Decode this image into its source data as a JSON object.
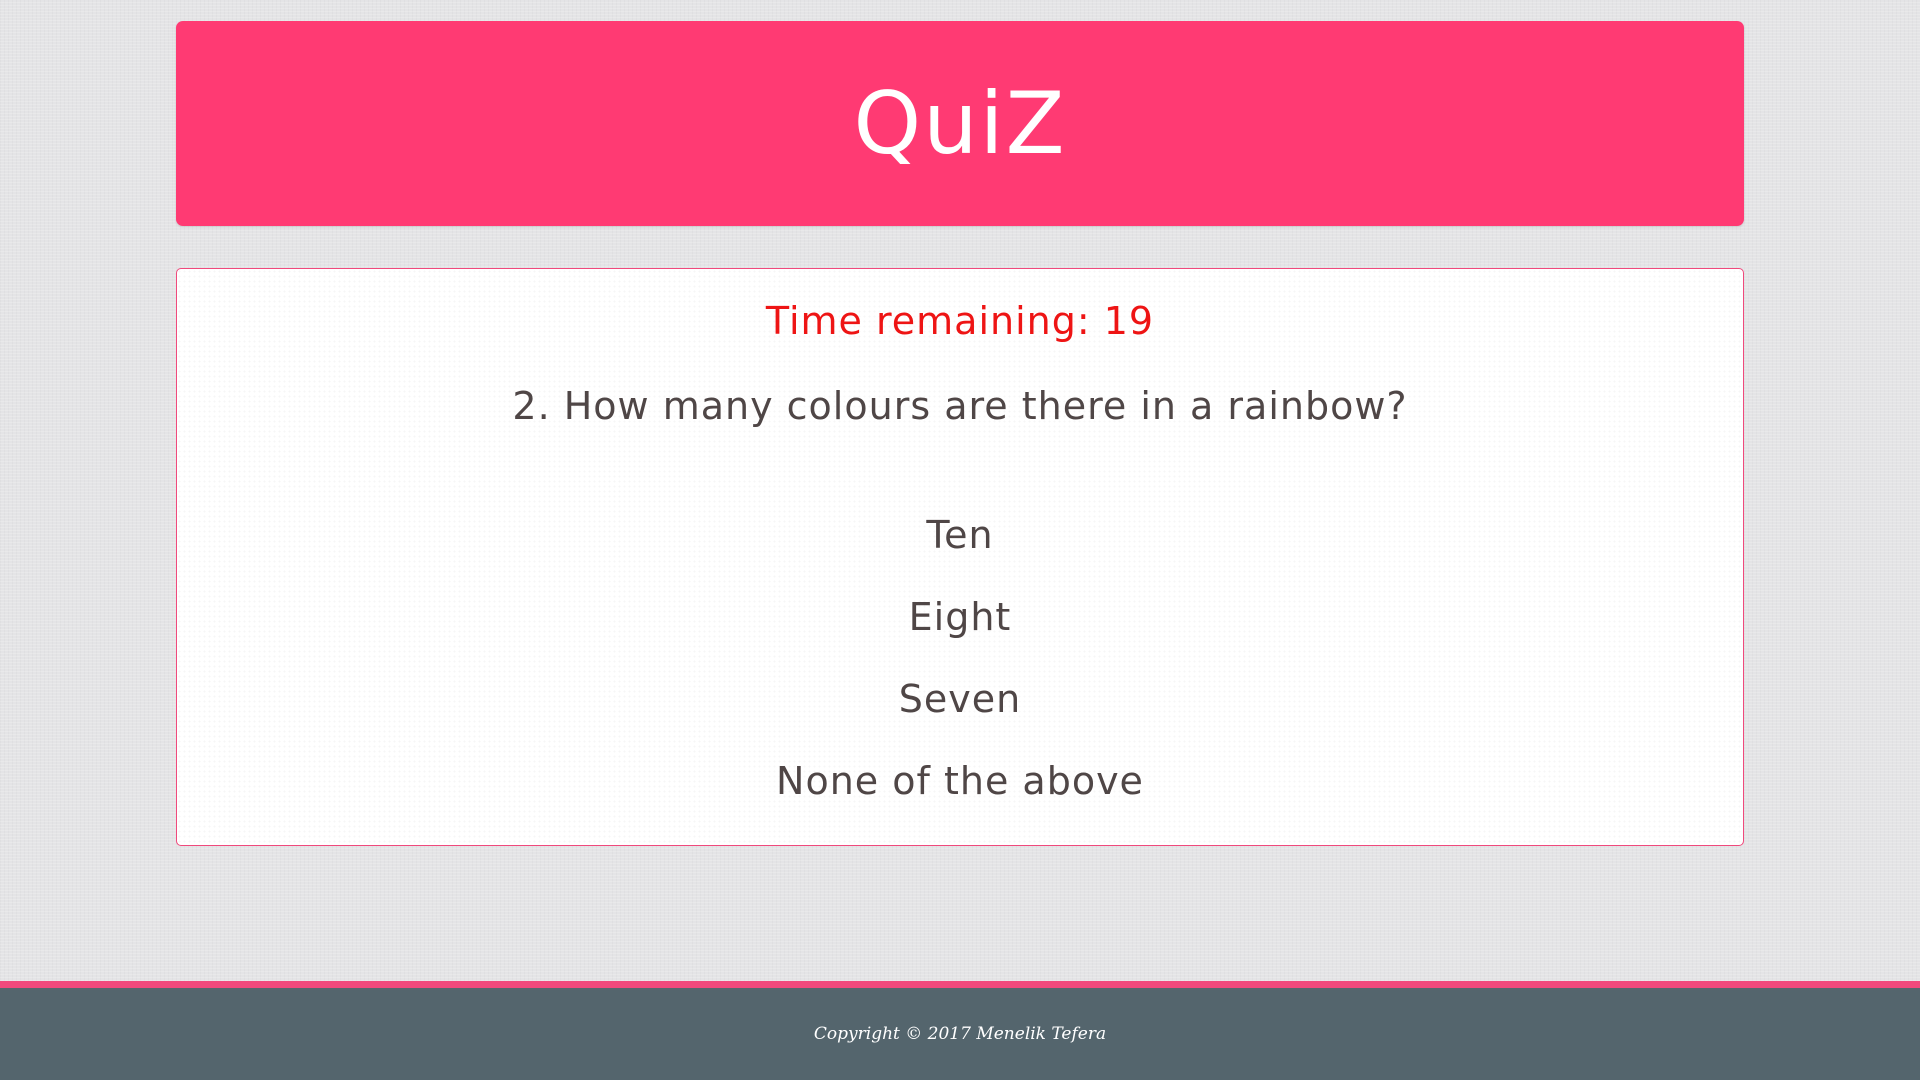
{
  "header": {
    "title": "QuiZ"
  },
  "quiz": {
    "timer_text": "Time remaining: 19",
    "question": "2. How many colours are there in a rainbow?",
    "answers": [
      "Ten",
      "Eight",
      "Seven",
      "None of the above"
    ]
  },
  "footer": {
    "copyright": "Copyright © 2017 Menelik Tefera"
  },
  "colors": {
    "brand_pink": "#ff3a73",
    "card_border": "#f0497c",
    "timer_red": "#ee1414",
    "text_dark": "#4f4646",
    "footer_bg": "#54656d",
    "page_bg": "#e4e4e6"
  }
}
